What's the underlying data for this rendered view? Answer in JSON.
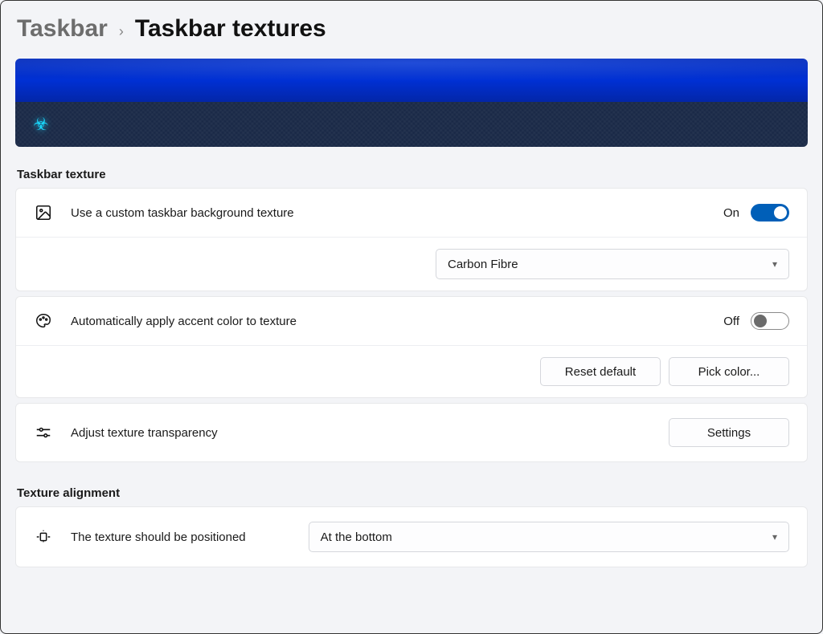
{
  "breadcrumb": {
    "root": "Taskbar",
    "current": "Taskbar textures"
  },
  "sections": {
    "texture": {
      "title": "Taskbar texture",
      "use_custom": {
        "label": "Use a custom taskbar background texture",
        "state": "On",
        "enabled": true
      },
      "texture_select": {
        "value": "Carbon Fibre"
      },
      "accent": {
        "label": "Automatically apply accent color to texture",
        "state": "Off",
        "enabled": false,
        "reset_btn": "Reset default",
        "pick_btn": "Pick color..."
      },
      "transparency": {
        "label": "Adjust texture transparency",
        "settings_btn": "Settings"
      }
    },
    "alignment": {
      "title": "Texture alignment",
      "position": {
        "label": "The texture should be positioned",
        "value": "At the bottom"
      }
    }
  }
}
